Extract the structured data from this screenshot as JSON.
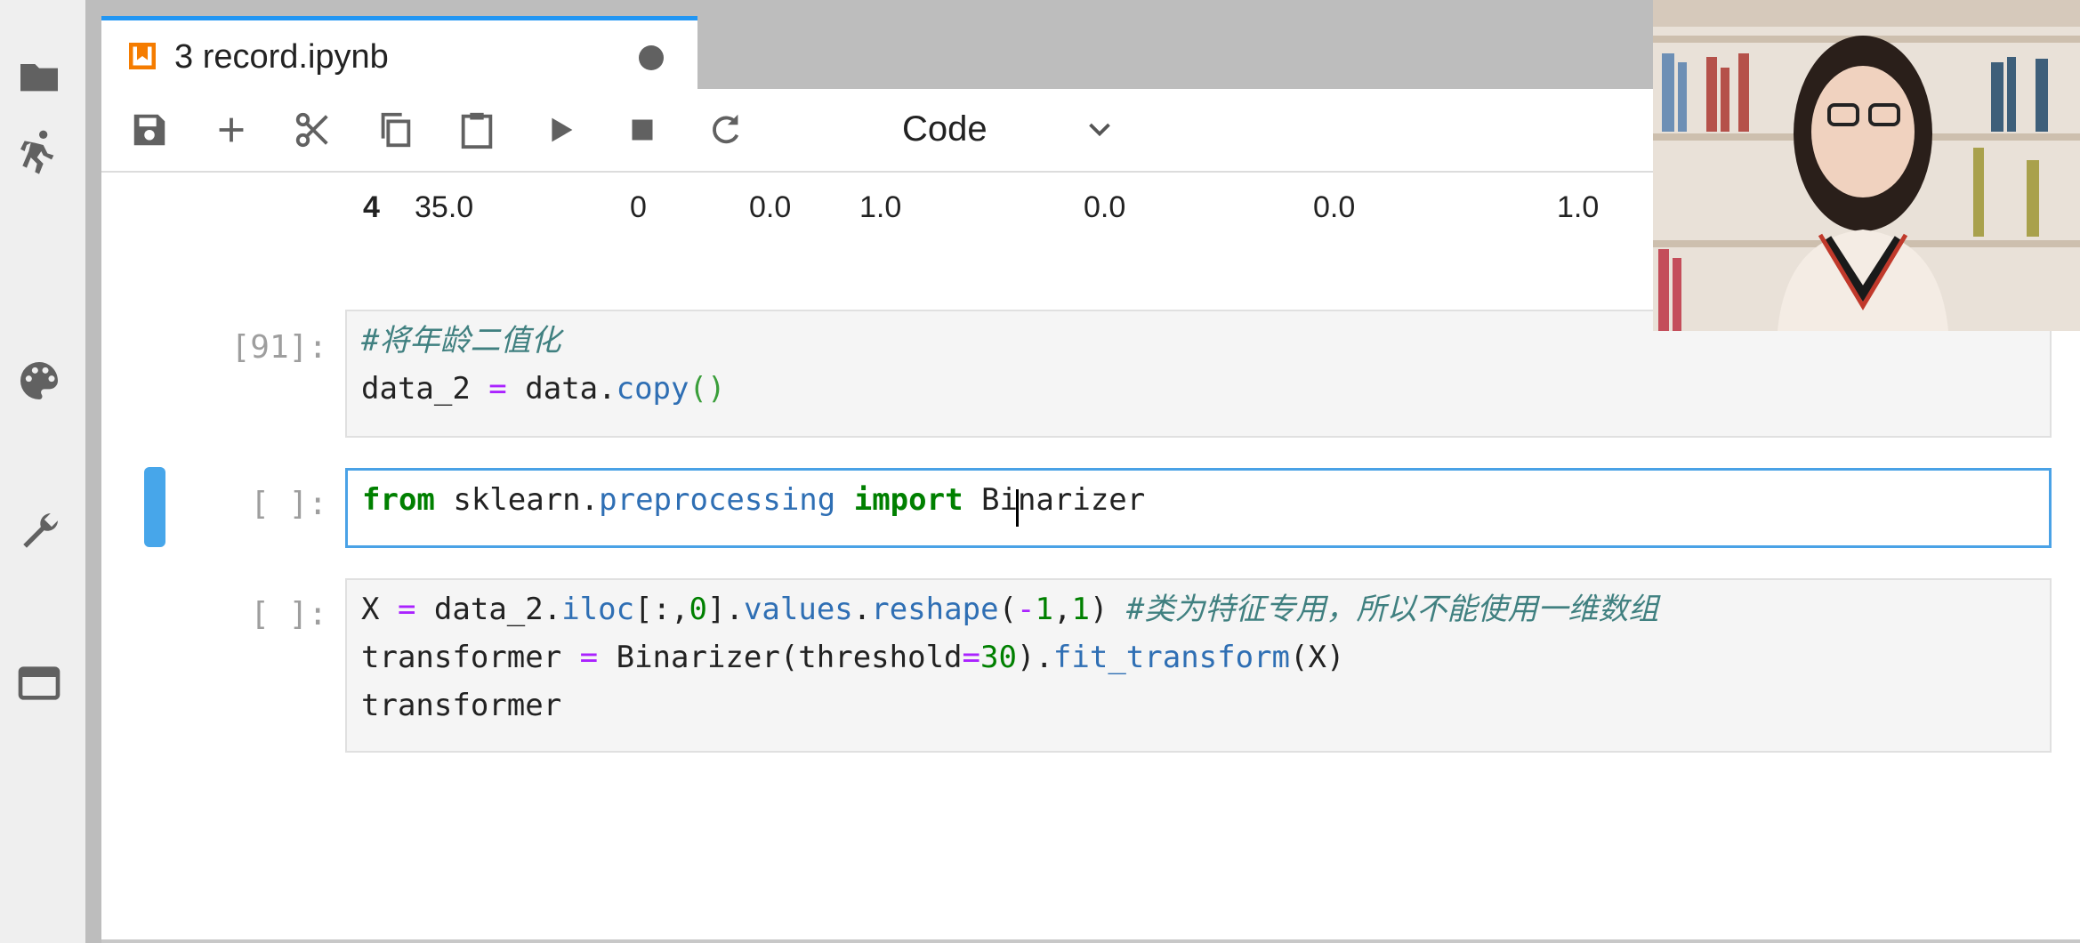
{
  "tab": {
    "title": "3 record.ipynb"
  },
  "toolbar": {
    "cell_type": "Code"
  },
  "left_sidebar": {
    "icons": [
      "folder-icon",
      "running-icon",
      "palette-icon",
      "wrench-icon",
      "tabs-icon"
    ]
  },
  "output_row": {
    "values": [
      "4",
      "35.0",
      "0",
      "0.0",
      "1.0",
      "0.0",
      "0.0",
      "1.0"
    ]
  },
  "cells": [
    {
      "prompt": "[91]:",
      "lines": [
        "#将年龄二值化",
        "data_2 = data.copy()"
      ]
    },
    {
      "prompt": "[ ]:",
      "lines": [
        "from sklearn.preprocessing import Binarizer"
      ]
    },
    {
      "prompt": "[ ]:",
      "lines": [
        "X = data_2.iloc[:,0].values.reshape(-1,1) #类为特征专用，所以不能使用一维数组",
        "transformer = Binarizer(threshold=30).fit_transform(X)",
        "transformer"
      ]
    }
  ],
  "colors": {
    "accent": "#2196f3",
    "active_cell_border": "#4aa2e6",
    "keyword": "#008000",
    "operator": "#aa22ff",
    "function": "#2f6fb4",
    "comment": "#408080"
  }
}
